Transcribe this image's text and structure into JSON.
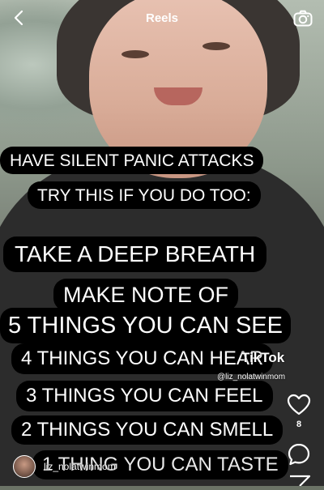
{
  "header": {
    "back_icon": "chevron-left-icon",
    "title": "Reels",
    "camera_icon": "camera-icon"
  },
  "captions": [
    "HAVE SILENT PANIC ATTACKS",
    "TRY THIS IF YOU DO TOO:",
    "TAKE A DEEP BREATH",
    "MAKE NOTE OF",
    "5 THINGS YOU CAN SEE",
    "4 THINGS YOU CAN HEAR",
    "3 THINGS YOU CAN FEEL",
    "2 THINGS YOU CAN SMELL",
    "1 THING YOU CAN TASTE"
  ],
  "watermark": {
    "logo": "TikTok",
    "user": "@liz_nolatwinmom"
  },
  "actions": {
    "like_icon": "heart-icon",
    "like_count": "8",
    "comment_icon": "comment-icon",
    "share_icon": "share-icon"
  },
  "author": {
    "username": "liz_nolatwinmom"
  }
}
